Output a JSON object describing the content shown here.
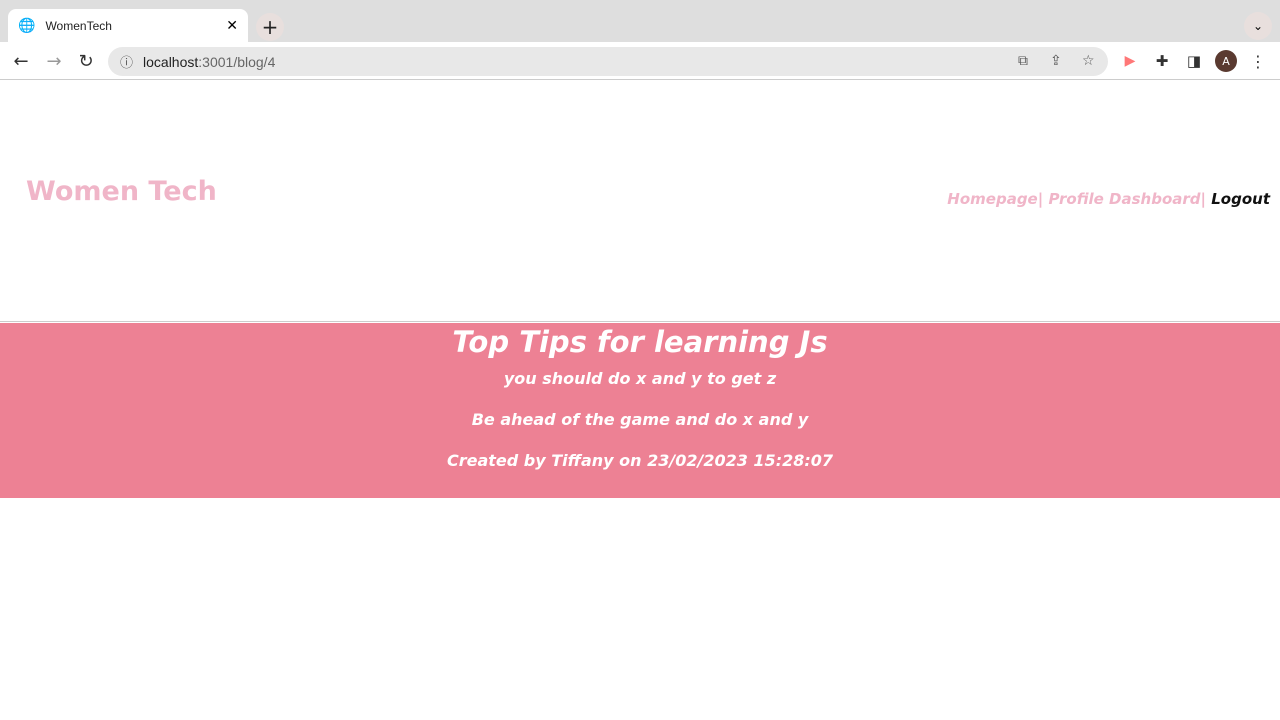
{
  "browser": {
    "tab_title": "WomenTech",
    "url_host": "localhost",
    "url_path": ":3001/blog/4",
    "avatar": "A"
  },
  "site": {
    "logo": "Women Tech",
    "nav": [
      "Homepage|",
      "Profile Dashboard|",
      "Logout"
    ]
  },
  "post": {
    "title": "Top Tips for learning Js",
    "subtitle": "you should do x and y to get z",
    "body": "Be ahead of the game and do x and y",
    "meta": "Created by Tiffany on 23/02/2023 15:28:07"
  }
}
